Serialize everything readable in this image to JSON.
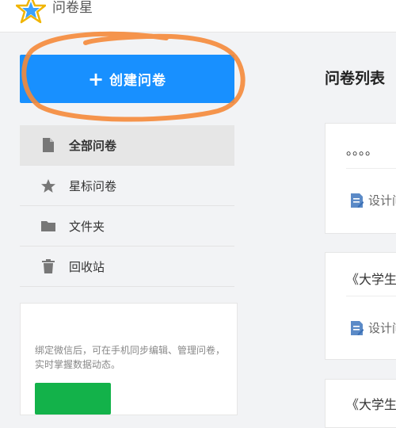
{
  "app": {
    "name": "问卷星"
  },
  "create_button": {
    "label": "创建问卷",
    "icon": "plus-icon"
  },
  "nav": {
    "items": [
      {
        "label": "全部问卷",
        "icon": "file-icon",
        "active": true
      },
      {
        "label": "星标问卷",
        "icon": "star-icon",
        "active": false
      },
      {
        "label": "文件夹",
        "icon": "folder-icon",
        "active": false
      },
      {
        "label": "回收站",
        "icon": "trash-icon",
        "active": false
      }
    ]
  },
  "wechat": {
    "text": "绑定微信后，可在手机同步编辑、管理问卷，实时掌握数据动态。"
  },
  "main": {
    "title": "问卷列表",
    "cards": [
      {
        "title": "。。。。",
        "action": "设计问"
      },
      {
        "title": "《大学生",
        "action": "设计问"
      },
      {
        "title": "《大学生"
      }
    ]
  },
  "colors": {
    "accent": "#1890ff",
    "annotation": "#f58a3a",
    "wechat_green": "#13b24a"
  }
}
